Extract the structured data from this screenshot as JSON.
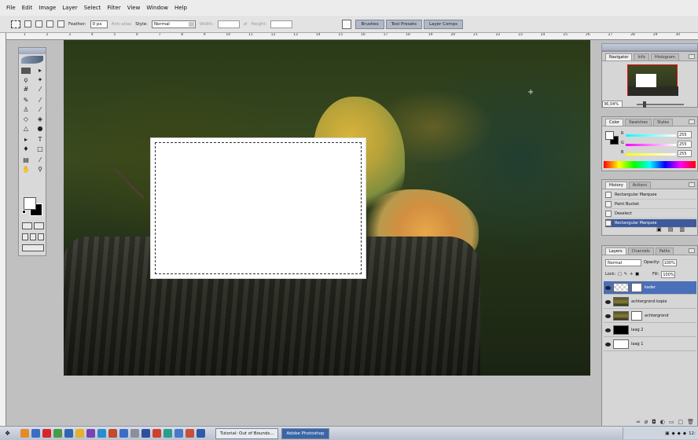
{
  "menu": [
    "File",
    "Edit",
    "Image",
    "Layer",
    "Select",
    "Filter",
    "View",
    "Window",
    "Help"
  ],
  "options": {
    "feather_label": "Feather:",
    "feather_value": "0 px",
    "antialias_label": "Anti-alias",
    "style_label": "Style:",
    "style_value": "Normal",
    "width_label": "Width:",
    "height_label": "Height:",
    "well_tabs": [
      "Brushes",
      "Tool Presets",
      "Layer Comps"
    ]
  },
  "ruler_numbers": [
    "1",
    "2",
    "3",
    "4",
    "5",
    "6",
    "7",
    "8",
    "9",
    "10",
    "11",
    "12",
    "13",
    "14",
    "15",
    "16",
    "17",
    "18",
    "19",
    "20",
    "21",
    "22",
    "23",
    "24",
    "25",
    "26",
    "27",
    "28",
    "29",
    "30"
  ],
  "navigator": {
    "tabs": [
      "Navigator",
      "Info",
      "Histogram"
    ],
    "zoom": "36,04%"
  },
  "color_panel": {
    "tabs": [
      "Color",
      "Swatches",
      "Styles"
    ],
    "channels": [
      {
        "label": "R",
        "value": "255",
        "gradient": "linear-gradient(90deg, #00ffff, #ffffff)"
      },
      {
        "label": "G",
        "value": "255",
        "gradient": "linear-gradient(90deg, #ff00ff, #ffffff)"
      },
      {
        "label": "B",
        "value": "255",
        "gradient": "linear-gradient(90deg, #ffff00, #ffffff)"
      }
    ]
  },
  "history": {
    "tabs": [
      "History",
      "Actions"
    ],
    "items": [
      "Rectangular Marquee",
      "Paint Bucket",
      "Deselect",
      "Rectangular Marquee"
    ],
    "active_index": 3
  },
  "layers_panel": {
    "tabs": [
      "Layers",
      "Channels",
      "Paths"
    ],
    "blend_mode": "Normal",
    "opacity_label": "Opacity:",
    "opacity_value": "100%",
    "lock_label": "Lock:",
    "fill_label": "Fill:",
    "fill_value": "100%",
    "layers": [
      {
        "name": "kader",
        "thumb": "checker",
        "has_mask": true,
        "active": true
      },
      {
        "name": "achtergrond kopie",
        "thumb": "photo",
        "has_mask": false,
        "active": false
      },
      {
        "name": "achtergrond",
        "thumb": "photo",
        "has_mask": true,
        "active": false
      },
      {
        "name": "laag 2",
        "thumb": "black",
        "has_mask": false,
        "active": false
      },
      {
        "name": "laag 1",
        "thumb": "white",
        "has_mask": false,
        "active": false
      }
    ]
  },
  "taskbar": {
    "buttons": [
      {
        "label": "Tutorial: Out of Bounds...",
        "active": false
      },
      {
        "label": "Adobe Photoshop",
        "active": true
      }
    ],
    "clock": "12:"
  },
  "colors": {
    "selection": "#ffffff",
    "active_blue": "#4b6fb8"
  }
}
